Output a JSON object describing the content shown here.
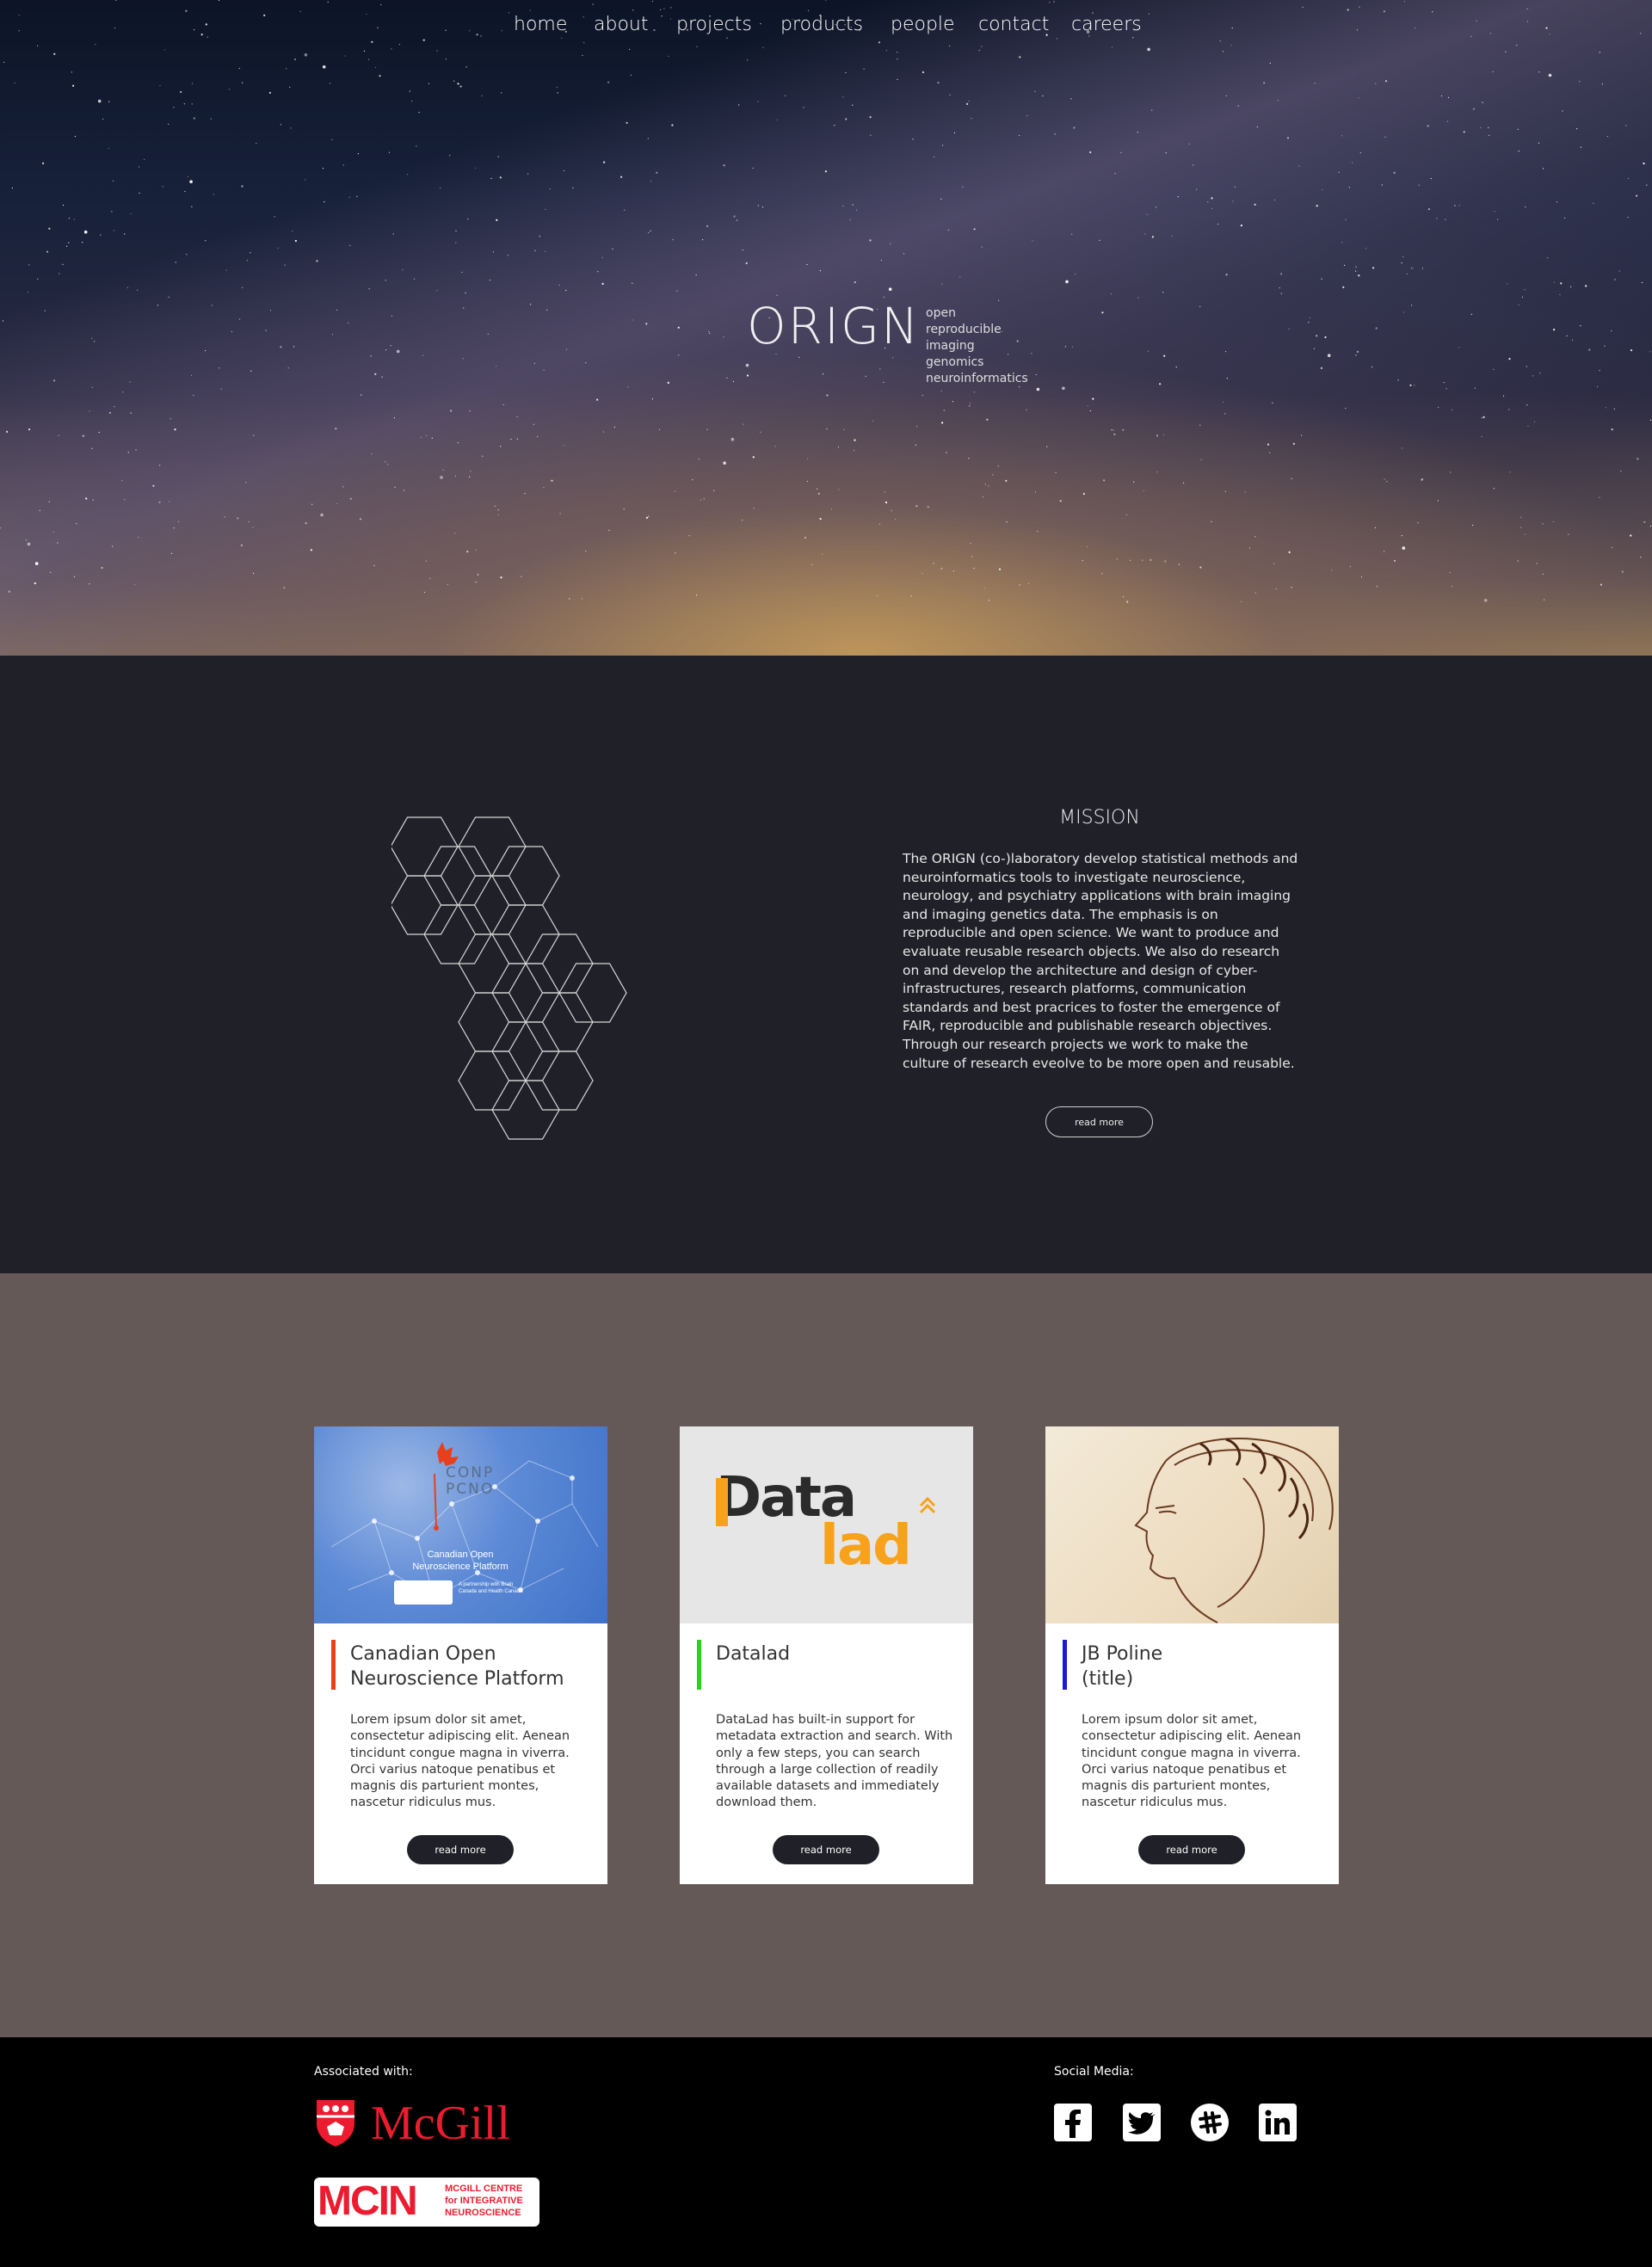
{
  "nav": {
    "items": [
      {
        "label": "home"
      },
      {
        "label": "about"
      },
      {
        "label": "projects"
      },
      {
        "label": "products"
      },
      {
        "label": "people"
      },
      {
        "label": "contact"
      },
      {
        "label": "careers"
      }
    ]
  },
  "hero": {
    "brand": "ORIGN",
    "tagline": [
      "open",
      "reproducible",
      "imaging",
      "genomics",
      "neuroinformatics"
    ]
  },
  "mission": {
    "title": "MISSION",
    "text": "The ORIGN (co-)laboratory develop statistical methods and neuroinformatics tools to investigate neuroscience, neurology, and psychiatry applications with brain imaging and imaging genetics data. The emphasis is on reproducible and open science. We want to produce and evaluate reusable research objects. We also do research on and develop the architecture and design of cyber-infrastructures, research platforms, communication standards and best pracrices to foster the emergence of FAIR, reproducible and publishable research objectives. Through our research projects we work to make the culture of research eveolve to be more open and reusable.",
    "button": "read more"
  },
  "cards": [
    {
      "title_line1": "Canadian Open",
      "title_line2": "Neuroscience Platform",
      "accent": "#e8401c",
      "image_logo": "CONP",
      "image_logo_fr": "PCNO",
      "image_caption": "Canadian Open Neuroscience Platform",
      "image_partner": "A partnership with Brain Canada and Health Canada",
      "description": "Lorem ipsum dolor sit amet, consectetur adipiscing elit. Aenean tincidunt congue magna in viverra. Orci varius natoque penatibus et magnis dis parturient montes, nascetur ridiculus mus.",
      "button": "read more"
    },
    {
      "title_line1": "Datalad",
      "title_line2": "",
      "accent": "#27d41a",
      "image_logo_top": "Data",
      "image_logo_bottom": "lad",
      "description": "DataLad has built-in support for metadata extraction and search. With only a few steps, you can search through a large collection of readily available datasets and immediately download them.",
      "button": "read more"
    },
    {
      "title_line1": "JB Poline",
      "title_line2": "(title)",
      "accent": "#1a1ad4",
      "description": "Lorem ipsum dolor sit amet, consectetur adipiscing elit. Aenean tincidunt congue magna in viverra. Orci varius natoque penatibus et magnis dis parturient montes, nascetur ridiculus mus.",
      "button": "read more"
    }
  ],
  "footer": {
    "associated_label": "Associated with:",
    "social_label": "Social Media:",
    "mcgill": "McGill",
    "mcin": "MCIN",
    "mcin_sub": [
      "MCGILL CENTRE",
      "for INTEGRATIVE",
      "NEUROSCIENCE"
    ],
    "social": [
      "facebook-icon",
      "twitter-icon",
      "slack-icon",
      "linkedin-icon"
    ],
    "colors": {
      "mcgill_red": "#ed1b2f"
    }
  }
}
